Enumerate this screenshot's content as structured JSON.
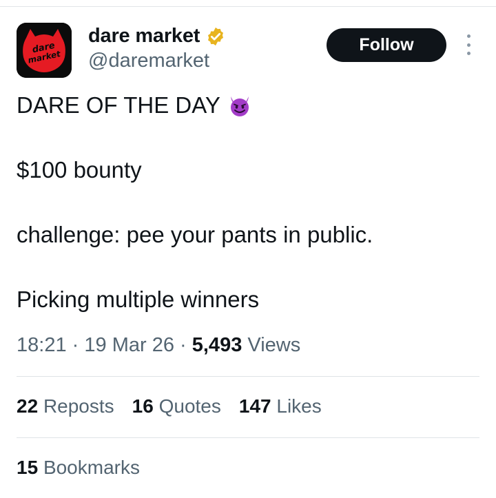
{
  "author": {
    "display_name": "dare market",
    "handle": "@daremarket",
    "avatar_logo_text": "dare market",
    "verified_badge_color": "#e8b420"
  },
  "follow_button": {
    "label": "Follow"
  },
  "more_icon": "more-vertical-icon",
  "tweet": {
    "line1": "DARE OF THE DAY",
    "line1_emoji": "smiling-devil-emoji",
    "line2": "$100 bounty",
    "line3": "challenge: pee your pants in public.",
    "line4": "Picking multiple winners"
  },
  "meta": {
    "time": "18:21",
    "dot1": "·",
    "date": "19 Mar 26",
    "dot2": "·",
    "views_count": "5,493",
    "views_label": "Views"
  },
  "stats": {
    "reposts_count": "22",
    "reposts_label": "Reposts",
    "quotes_count": "16",
    "quotes_label": "Quotes",
    "likes_count": "147",
    "likes_label": "Likes",
    "bookmarks_count": "15",
    "bookmarks_label": "Bookmarks"
  },
  "colors": {
    "text_primary": "#0f1419",
    "text_secondary": "#536471",
    "avatar_red": "#e51b23",
    "emoji_purple": "#a33cc8"
  }
}
